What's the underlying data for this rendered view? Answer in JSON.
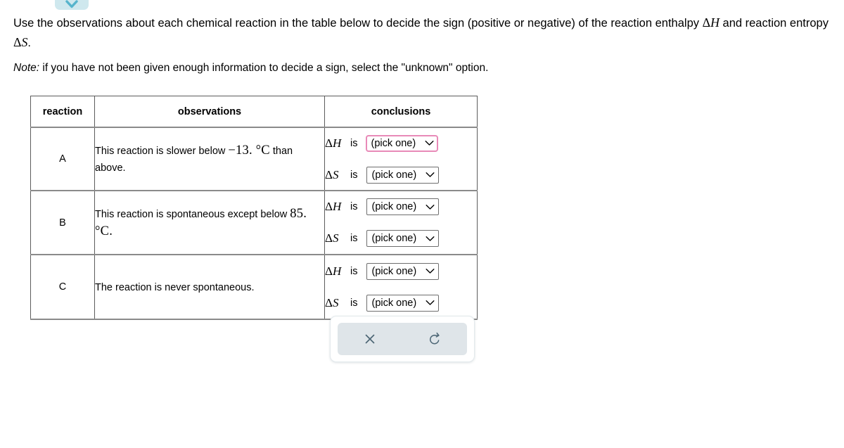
{
  "top_widget": {
    "icon": "chevron-down-icon",
    "pill_color": "#cfe8ee",
    "chevron_color": "#56b4cc"
  },
  "prompt": {
    "text_part1": "Use the observations about each chemical reaction in the table below to decide the sign (positive or negative) of the reaction enthalpy ",
    "symbol_enthalpy_delta": "Δ",
    "symbol_enthalpy_var": "H",
    "text_part2": " and reaction entropy ",
    "symbol_entropy_delta": "Δ",
    "symbol_entropy_var": "S",
    "text_part3": "."
  },
  "note": {
    "label": "Note:",
    "text": " if you have not been given enough information to decide a sign, select the \"unknown\" option."
  },
  "table": {
    "headers": {
      "reaction": "reaction",
      "observations": "observations",
      "conclusions": "conclusions"
    },
    "rows": [
      {
        "reaction": "A",
        "observation_pre": "This reaction is slower below ",
        "observation_math": "−13. °C",
        "observation_post": " than above.",
        "conclusions": [
          {
            "delta": "Δ",
            "var": "H",
            "is": "is",
            "value": "(pick one)",
            "focused": true
          },
          {
            "delta": "Δ",
            "var": "S",
            "is": "is",
            "value": "(pick one)",
            "focused": false
          }
        ]
      },
      {
        "reaction": "B",
        "observation_pre": "This reaction is spontaneous except below ",
        "observation_math": "85. °C.",
        "observation_post": "",
        "conclusions": [
          {
            "delta": "Δ",
            "var": "H",
            "is": "is",
            "value": "(pick one)",
            "focused": false
          },
          {
            "delta": "Δ",
            "var": "S",
            "is": "is",
            "value": "(pick one)",
            "focused": false
          }
        ]
      },
      {
        "reaction": "C",
        "observation_pre": "The reaction is never spontaneous.",
        "observation_math": "",
        "observation_post": "",
        "conclusions": [
          {
            "delta": "Δ",
            "var": "H",
            "is": "is",
            "value": "(pick one)",
            "focused": false
          },
          {
            "delta": "Δ",
            "var": "S",
            "is": "is",
            "value": "(pick one)",
            "focused": false
          }
        ]
      }
    ]
  },
  "action_panel": {
    "clear_icon": "close-x-icon",
    "reset_icon": "undo-reset-icon",
    "icon_color": "#4d6675",
    "panel_bg": "#dfe5e9"
  },
  "colors": {
    "focus_border": "#e88ab8",
    "select_border": "#6e6e6e",
    "grid_border": "#5c5c5c",
    "row_divider": "#8a8a8a"
  }
}
